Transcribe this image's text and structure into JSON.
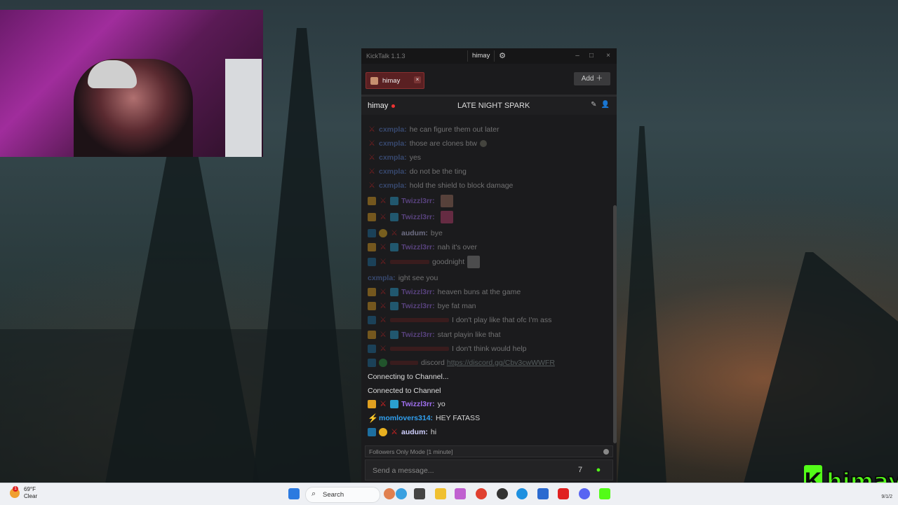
{
  "kicktalk": {
    "app_title": "KickTalk 1.1.3",
    "active_tab": "himay",
    "channel_tab_label": "himay",
    "add_label": "Add ＋",
    "channel_name": "himay",
    "stream_title": "LATE NIGHT SPARK",
    "messages": [
      {
        "user": "cxmpla:",
        "text": "he can figure them out later",
        "user_color": "#5a7fd0"
      },
      {
        "user": "cxmpla:",
        "text": "those are clones btw",
        "user_color": "#5a7fd0"
      },
      {
        "user": "cxmpla:",
        "text": "yes",
        "user_color": "#5a7fd0"
      },
      {
        "user": "cxmpla:",
        "text": "do not be the ting",
        "user_color": "#5a7fd0"
      },
      {
        "user": "cxmpla:",
        "text": "hold the shield to block damage",
        "user_color": "#5a7fd0"
      },
      {
        "user": "Twizzl3rr:",
        "text": "",
        "user_color": "#a070f0"
      },
      {
        "user": "Twizzl3rr:",
        "text": "",
        "user_color": "#a070f0"
      },
      {
        "user": "audum:",
        "text": "bye",
        "user_color": "#d0d0ff"
      },
      {
        "user": "Twizzl3rr:",
        "text": "nah it's over",
        "user_color": "#a070f0"
      },
      {
        "user": "",
        "text": "goodnight",
        "user_color": "#c03030"
      },
      {
        "user": "cxmpla:",
        "text": "ight see you",
        "user_color": "#5a7fd0"
      },
      {
        "user": "Twizzl3rr:",
        "text": "heaven buns at the game",
        "user_color": "#a070f0"
      },
      {
        "user": "Twizzl3rr:",
        "text": "bye fat man",
        "user_color": "#a070f0"
      },
      {
        "user": "",
        "text": "I don't play like that ofc I'm ass",
        "user_color": "#c03030"
      },
      {
        "user": "Twizzl3rr:",
        "text": "start playin like that",
        "user_color": "#a070f0"
      },
      {
        "user": "",
        "text": "I don't think would help",
        "user_color": "#c03030"
      },
      {
        "user": "",
        "text": "discord",
        "link": "https://discord.gg/Cbv3cwWWFR",
        "user_color": "#c03030"
      }
    ],
    "system_1": "Connecting to Channel...",
    "system_2": "Connected to Channel",
    "recent": [
      {
        "user": "Twizzl3rr:",
        "text": "yo",
        "user_color": "#a070f0"
      },
      {
        "user": "momlovers314:",
        "text": "HEY FATASS",
        "user_color": "#30a0f0"
      },
      {
        "user": "audum:",
        "text": "hi",
        "user_color": "#d0d0ff"
      }
    ],
    "followers_mode": "Followers Only Mode [1 minute]",
    "input_placeholder": "Send a message..."
  },
  "taskbar": {
    "weather_temp": "69°F",
    "weather_cond": "Clear",
    "weather_badge": "1",
    "search_label": "Search",
    "clock": "9/1/2"
  },
  "overlay": {
    "brand_logo": "K",
    "brand_name": "himay"
  }
}
